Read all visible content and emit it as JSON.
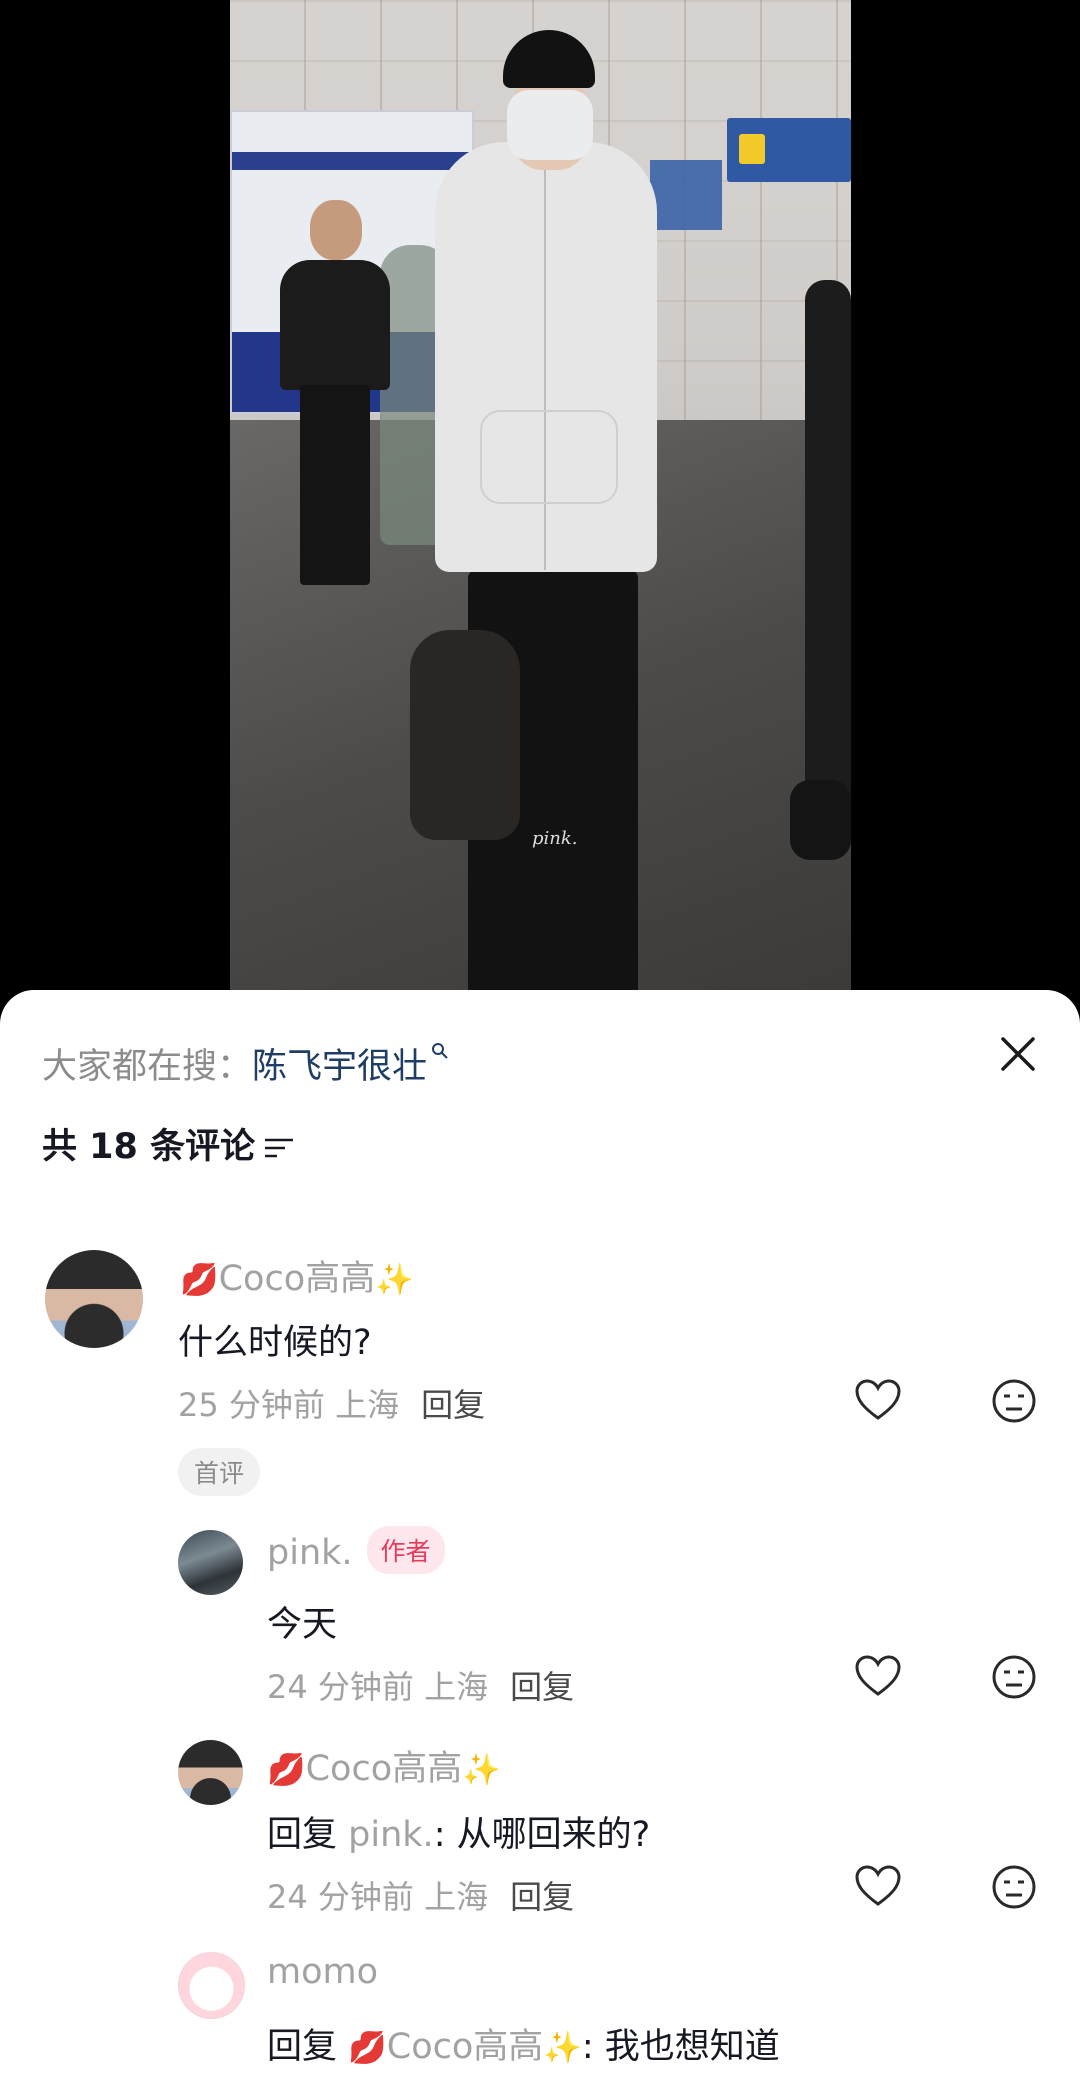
{
  "video": {
    "watermark": "pink."
  },
  "sheet": {
    "search_prefix": "大家都在搜：",
    "search_term": "陈飞宇很壮",
    "comment_count_label": "共 18 条评论"
  },
  "comments": [
    {
      "emoji": "💋",
      "name": "Coco高高",
      "name_suffix": "✨",
      "text": "什么时候的?",
      "time": "25 分钟前",
      "location": "上海",
      "reply_label": "回复",
      "badge": "首评"
    },
    {
      "name": "pink.",
      "author_badge": "作者",
      "text": "今天",
      "time": "24 分钟前",
      "location": "上海",
      "reply_label": "回复"
    },
    {
      "emoji": "💋",
      "name": "Coco高高",
      "name_suffix": "✨",
      "reply_prefix": "回复",
      "reply_to": "pink.",
      "text": ": 从哪回来的?",
      "time": "24 分钟前",
      "location": "上海",
      "reply_label": "回复"
    },
    {
      "name": "momo",
      "reply_prefix": "回复",
      "reply_to_emoji": "💋",
      "reply_to": "Coco高高",
      "reply_to_suffix": "✨",
      "text": ": 我也想知道"
    }
  ]
}
